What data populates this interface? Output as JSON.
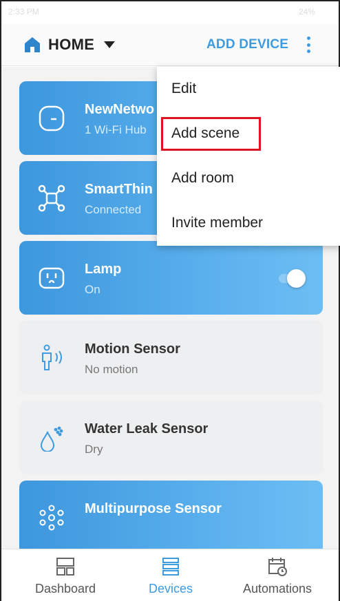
{
  "statusbar": {
    "time": "2:33 PM",
    "battery": "24%"
  },
  "header": {
    "title": "HOME",
    "add_device_label": "ADD DEVICE"
  },
  "devices": [
    {
      "name": "NewNetwo",
      "status": "1 Wi-Fi Hub",
      "icon": "hub-icon",
      "active": true
    },
    {
      "name": "SmartThin",
      "status": "Connected",
      "icon": "network-icon",
      "active": true
    },
    {
      "name": "Lamp",
      "status": "On",
      "icon": "outlet-icon",
      "active": true,
      "toggle": "on"
    },
    {
      "name": "Motion Sensor",
      "status": "No motion",
      "icon": "motion-icon",
      "active": false
    },
    {
      "name": "Water Leak Sensor",
      "status": "Dry",
      "icon": "water-drop-icon",
      "active": false
    },
    {
      "name": "Multipurpose Sensor",
      "status": "",
      "icon": "multipurpose-icon",
      "active": true
    }
  ],
  "menu": {
    "items": [
      {
        "label": "Edit"
      },
      {
        "label": "Add scene"
      },
      {
        "label": "Add room"
      },
      {
        "label": "Invite member"
      }
    ]
  },
  "bottom_nav": {
    "tabs": [
      {
        "label": "Dashboard",
        "icon": "dashboard-icon",
        "selected": false
      },
      {
        "label": "Devices",
        "icon": "devices-icon",
        "selected": true
      },
      {
        "label": "Automations",
        "icon": "automations-icon",
        "selected": false
      }
    ]
  },
  "colors": {
    "accent": "#3d9be0",
    "card_active": "#4fa8e8",
    "card_inactive": "#eeeff0",
    "highlight": "#e0141e"
  }
}
